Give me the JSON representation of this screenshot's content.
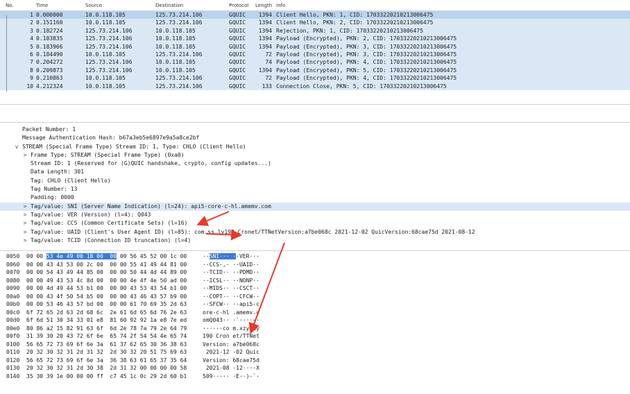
{
  "columns": {
    "no": "No.",
    "time": "Time",
    "source": "Source",
    "destination": "Destination",
    "protocol": "Protocol",
    "length": "Length",
    "info": "Info"
  },
  "packets": [
    {
      "no": "1",
      "time": "0.000000",
      "src": "10.0.118.105",
      "dst": "125.73.214.106",
      "proto": "GQUIC",
      "len": "1394",
      "info": "Client Hello, PKN: 1, CID: 17033220210213006475"
    },
    {
      "no": "2",
      "time": "0.151160",
      "src": "10.0.118.105",
      "dst": "125.73.214.106",
      "proto": "GQUIC",
      "len": "1394",
      "info": "Client Hello, PKN: 2, CID: 17033220210213006475"
    },
    {
      "no": "3",
      "time": "0.182724",
      "src": "125.73.214.106",
      "dst": "10.0.118.105",
      "proto": "GQUIC",
      "len": "1394",
      "info": "Rejection, PKN: 1, CID: 17033220210213006475"
    },
    {
      "no": "4",
      "time": "0.183835",
      "src": "125.73.214.106",
      "dst": "10.0.118.105",
      "proto": "GQUIC",
      "len": "1394",
      "info": "Payload (Encrypted), PKN: 2, CID: 17033220210213006475"
    },
    {
      "no": "5",
      "time": "0.183966",
      "src": "125.73.214.106",
      "dst": "10.0.118.105",
      "proto": "GQUIC",
      "len": "1394",
      "info": "Payload (Encrypted), PKN: 3, CID: 17033220210213006475"
    },
    {
      "no": "6",
      "time": "0.184490",
      "src": "10.0.118.105",
      "dst": "125.73.214.106",
      "proto": "GQUIC",
      "len": "72",
      "info": "Payload (Encrypted), PKN: 3, CID: 17033220210213006475"
    },
    {
      "no": "7",
      "time": "0.204272",
      "src": "125.73.214.106",
      "dst": "10.0.118.105",
      "proto": "GQUIC",
      "len": "74",
      "info": "Payload (Encrypted), PKN: 4, CID: 17033220210213006475"
    },
    {
      "no": "8",
      "time": "0.209873",
      "src": "125.73.214.106",
      "dst": "10.0.118.105",
      "proto": "GQUIC",
      "len": "1394",
      "info": "Payload (Encrypted), PKN: 5, CID: 17033220210213006475"
    },
    {
      "no": "9",
      "time": "0.210863",
      "src": "10.0.118.105",
      "dst": "125.73.214.106",
      "proto": "GQUIC",
      "len": "72",
      "info": "Payload (Encrypted), PKN: 4, CID: 17033220210213006475"
    },
    {
      "no": "10",
      "time": "4.212324",
      "src": "10.0.118.105",
      "dst": "125.73.214.106",
      "proto": "GQUIC",
      "len": "133",
      "info": "Connection Close, PKN: 5, CID: 17033220210213006475"
    }
  ],
  "details": [
    {
      "indent": 0,
      "tw": "",
      "text": "Packet Number: 1"
    },
    {
      "indent": 0,
      "tw": "",
      "text": "Message Authentication Hash: b67a3eb5e6897e9a5a8ce2bf"
    },
    {
      "indent": 0,
      "tw": "v",
      "text": "STREAM (Special Frame Type) Stream ID: 1, Type: CHLO (Client Hello)"
    },
    {
      "indent": 1,
      "tw": ">",
      "text": "Frame Type: STREAM (Special Frame Type) (0xa0)"
    },
    {
      "indent": 1,
      "tw": "",
      "text": "Stream ID: 1 (Reserved for (G)QUIC handshake, crypto, config updates...)"
    },
    {
      "indent": 1,
      "tw": "",
      "text": "Data Length: 301"
    },
    {
      "indent": 1,
      "tw": "",
      "text": "Tag: CHLO (Client Hello)"
    },
    {
      "indent": 1,
      "tw": "",
      "text": "Tag Number: 13"
    },
    {
      "indent": 1,
      "tw": "",
      "text": "Padding: 0000"
    },
    {
      "indent": 1,
      "tw": ">",
      "text": "Tag/value: SNI (Server Name Indication) (l=24): api5-core-c-hl.amemv.com",
      "hl": true
    },
    {
      "indent": 1,
      "tw": ">",
      "text": "Tag/value: VER (Version) (l=4): Q043"
    },
    {
      "indent": 1,
      "tw": ">",
      "text": "Tag/value: CCS (Common Certificate Sets) (l=16)"
    },
    {
      "indent": 1,
      "tw": ">",
      "text": "Tag/value: UAID (Client's User Agent ID) (l=85): com.ss.ly190 Cronet/TTNetVersion:a7be068c 2021-12-02 QuicVersion:68cae75d 2021-08-12"
    },
    {
      "indent": 1,
      "tw": ">",
      "text": "Tag/value: TCID (Connection ID truncation) (l=4)"
    }
  ],
  "hex": [
    {
      "off": "0050",
      "bytes": "00 00 53 4e 49 00 18 00  00 00 56 45 52 00 1c 00",
      "ascii": "··SNI··· ··VER···"
    },
    {
      "off": "0060",
      "bytes": "00 00 43 43 53 00 2c 00  00 00 55 41 49 44 81 00",
      "ascii": "··CCS·,· ··UAID··"
    },
    {
      "off": "0070",
      "bytes": "00 00 54 43 49 44 85 00  00 00 50 44 4d 44 89 00",
      "ascii": "··TCID·· ··PDMD··"
    },
    {
      "off": "0080",
      "bytes": "00 00 49 43 53 4c 8d 00  00 00 4e 4f 4e 50 ad 00",
      "ascii": "··ICSL·· ··NONP··"
    },
    {
      "off": "0090",
      "bytes": "00 00 4d 49 44 53 b1 00  00 00 43 53 43 54 b1 00",
      "ascii": "··MIDS·· ··CSCT··"
    },
    {
      "off": "00a0",
      "bytes": "00 00 43 4f 50 54 b5 00  00 00 43 46 43 57 b9 00",
      "ascii": "··COPT·· ··CFCW··"
    },
    {
      "off": "00b0",
      "bytes": "00 00 53 46 43 57 bd 00  00 00 61 70 69 35 2d 63",
      "ascii": "··SFCW·· ··api5-c"
    },
    {
      "off": "00c0",
      "bytes": "6f 72 65 2d 63 2d 68 6c  2e 61 6d 65 6d 76 2e 63",
      "ascii": "ore-c-hl .amemv.c"
    },
    {
      "off": "00d0",
      "bytes": "6f 6d 51 30 34 33 01 e8  81 60 92 92 1a e8 7e ed",
      "ascii": "omQ043·· ·`····~·"
    },
    {
      "off": "00e0",
      "bytes": "80 86 a2 15 82 91 63 6f  6d 2e 78 7a 79 2e 64 79",
      "ascii": "······co m.xzy.dy"
    },
    {
      "off": "00f0",
      "bytes": "31 39 30 20 43 72 6f 6e  65 74 2f 54 54 4e 65 74",
      "ascii": "190 Cron et/TTNet"
    },
    {
      "off": "0100",
      "bytes": "56 65 72 73 69 6f 6e 3a  61 37 62 65 30 36 38 63",
      "ascii": "Version: a7be068c"
    },
    {
      "off": "0110",
      "bytes": "20 32 30 32 31 2d 31 32  2d 30 32 20 51 75 69 63",
      "ascii": " 2021-12 -02 Quic"
    },
    {
      "off": "0120",
      "bytes": "56 65 72 73 69 6f 6e 3a  36 38 63 61 65 37 35 64",
      "ascii": "Version: 68cae75d"
    },
    {
      "off": "0130",
      "bytes": "20 32 30 32 31 2d 30 38  2d 31 32 00 00 00 00 58",
      "ascii": " 2021-08 -12····X"
    },
    {
      "off": "0140",
      "bytes": "35 30 39 1e 00 00 00 ff  c7 45 1c 0c 29 2d 60 b1",
      "ascii": "509····· ·E··)-`·"
    }
  ],
  "colors": {
    "row": "#dae8f6",
    "selected": "#b9d4ee",
    "hex_highlight": "#3b7ad6",
    "arrow": "#e8382a"
  }
}
